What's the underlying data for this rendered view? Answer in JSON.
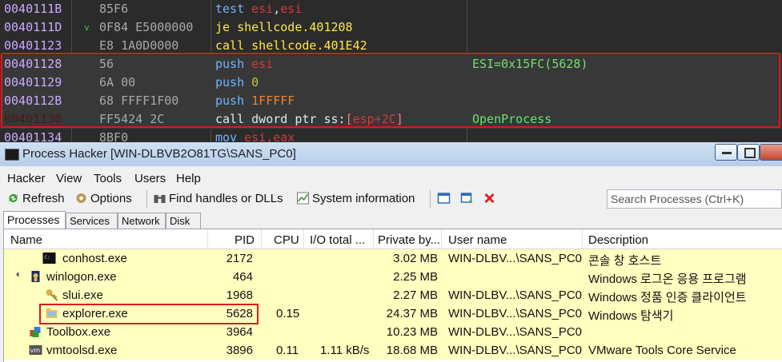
{
  "disassembly": {
    "rows": [
      {
        "addr": "0040111B",
        "arrow": "",
        "bytes": "85F6",
        "comment": ""
      },
      {
        "addr": "0040111D",
        "arrow": "v",
        "bytes": "0F84 E5000000",
        "comment": ""
      },
      {
        "addr": "00401123",
        "arrow": "",
        "bytes": "E8 1A0D0000",
        "comment": ""
      },
      {
        "addr": "00401128",
        "arrow": "",
        "bytes": "56",
        "comment": "ESI=0x15FC(5628)"
      },
      {
        "addr": "00401129",
        "arrow": "",
        "bytes": "6A 00",
        "comment": ""
      },
      {
        "addr": "0040112B",
        "arrow": "",
        "bytes": "68 FFFF1F00",
        "comment": ""
      },
      {
        "addr": "00401130",
        "arrow": "",
        "bytes": "FF5424 2C",
        "comment": "OpenProcess"
      },
      {
        "addr": "00401134",
        "arrow": "",
        "bytes": "8BF0",
        "comment": ""
      }
    ],
    "instr": {
      "r0_op": "test",
      "r0_a": "esi",
      "r0_comma": ",",
      "r0_b": "esi",
      "r1_op": "je",
      "r1_a": "shellcode.401208",
      "r2_op": "call",
      "r2_a": "shellcode.401E42",
      "r3_op": "push",
      "r3_a": "esi",
      "r4_op": "push",
      "r4_a": "0",
      "r5_op": "push",
      "r5_a": "1FFFFF",
      "r6_op": "call",
      "r6_a": "dword ptr ss:",
      "r6_lb": "[",
      "r6_b": "esp+2C",
      "r6_rb": "]",
      "r7_op": "mov",
      "r7_a": "esi,eax"
    }
  },
  "window": {
    "title": "Process Hacker [WIN-DLBVB2O81TG\\SANS_PC0]"
  },
  "menu": [
    "Hacker",
    "View",
    "Tools",
    "Users",
    "Help"
  ],
  "toolbar": {
    "refresh": "Refresh",
    "options": "Options",
    "find": "Find handles or DLLs",
    "sysinfo": "System information",
    "search_placeholder": "Search Processes (Ctrl+K)"
  },
  "tabs": [
    "Processes",
    "Services",
    "Network",
    "Disk"
  ],
  "columns": [
    "Name",
    "PID",
    "CPU",
    "I/O total ...",
    "Private by...",
    "User name",
    "Description"
  ],
  "processes": [
    {
      "name": "conhost.exe",
      "pid": "2172",
      "cpu": "",
      "io": "",
      "priv": "3.02 MB",
      "user": "WIN-DLBV...\\SANS_PC0",
      "desc": "콘솔 창 호스트",
      "icon": "console-icon"
    },
    {
      "name": "winlogon.exe",
      "pid": "464",
      "cpu": "",
      "io": "",
      "priv": "2.25 MB",
      "user": "",
      "desc": "Windows 로그온 응용 프로그램",
      "icon": "winlogon-icon"
    },
    {
      "name": "slui.exe",
      "pid": "1968",
      "cpu": "",
      "io": "",
      "priv": "2.27 MB",
      "user": "WIN-DLBV...\\SANS_PC0",
      "desc": "Windows 정품 인증 클라이언트",
      "icon": "key-icon"
    },
    {
      "name": "explorer.exe",
      "pid": "5628",
      "cpu": "0.15",
      "io": "",
      "priv": "24.37 MB",
      "user": "WIN-DLBV...\\SANS_PC0",
      "desc": "Windows 탐색기",
      "icon": "folder-icon"
    },
    {
      "name": "Toolbox.exe",
      "pid": "3964",
      "cpu": "",
      "io": "",
      "priv": "10.23 MB",
      "user": "WIN-DLBV...\\SANS_PC0",
      "desc": "",
      "icon": "toolbox-icon"
    },
    {
      "name": "vmtoolsd.exe",
      "pid": "3896",
      "cpu": "0.11",
      "io": "1.11 kB/s",
      "priv": "18.68 MB",
      "user": "WIN-DLBV...\\SANS_PC0",
      "desc": "VMware Tools Core Service",
      "icon": "vm-icon"
    }
  ],
  "colors": {
    "highlight_box": "#e01818",
    "row_yellow": "#ffffc0",
    "disasm_bg": "#2b2b2b"
  }
}
